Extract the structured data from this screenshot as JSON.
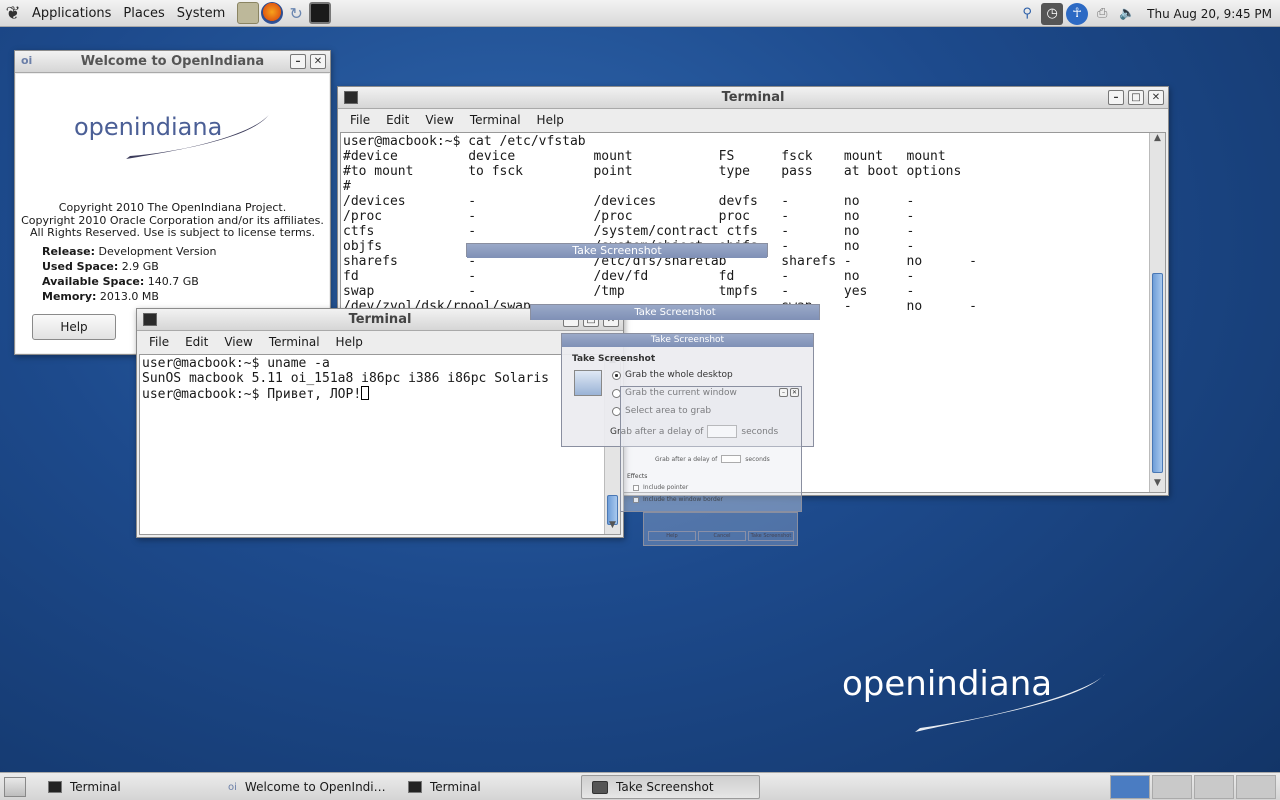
{
  "top_panel": {
    "menus": [
      "Applications",
      "Places",
      "System"
    ],
    "clock": "Thu Aug 20,  9:45 PM",
    "launchers": [
      "home-folder-icon",
      "firefox-icon",
      "update-icon",
      "terminal-icon"
    ],
    "tray_icons": [
      "search-icon",
      "clock-icon",
      "accessibility-icon",
      "printer-icon",
      "volume-icon"
    ]
  },
  "welcome": {
    "title": "Welcome to OpenIndiana",
    "logo_text": "openindiana",
    "copyright": [
      "Copyright 2010 The OpenIndiana Project.",
      "Copyright 2010 Oracle Corporation and/or its affiliates.",
      "All Rights Reserved. Use is subject to license terms."
    ],
    "release_label": "Release:",
    "release_value": "Development Version",
    "used_label": "Used Space:",
    "used_value": "2.9 GB",
    "avail_label": "Available Space:",
    "avail_value": "140.7 GB",
    "mem_label": "Memory:",
    "mem_value": "2013.0 MB",
    "help_button": "Help"
  },
  "terminal_big": {
    "title": "Terminal",
    "menus": [
      "File",
      "Edit",
      "View",
      "Terminal",
      "Help"
    ],
    "lines": [
      "user@macbook:~$ cat /etc/vfstab",
      "#device         device          mount           FS      fsck    mount   mount",
      "#to mount       to fsck         point           type    pass    at boot options",
      "#",
      "/devices        -               /devices        devfs   -       no      -",
      "/proc           -               /proc           proc    -       no      -",
      "ctfs            -               /system/contract ctfs   -       no      -",
      "objfs           -               /system/object  objfs   -       no      -",
      "sharefs         -               /etc/dfs/sharetab       sharefs -       no      -",
      "fd              -               /dev/fd         fd      -       no      -",
      "swap            -               /tmp            tmpfs   -       yes     -",
      "/dev/zvol/dsk/rpool/swap        -               -       swap    -       no      -"
    ]
  },
  "terminal_small": {
    "title": "Terminal",
    "menus": [
      "File",
      "Edit",
      "View",
      "Terminal",
      "Help"
    ],
    "lines": [
      "user@macbook:~$ uname -a",
      "SunOS macbook 5.11 oi_151a8 i86pc i386 i86pc Solaris",
      "user@macbook:~$ Привет, ЛОР!"
    ]
  },
  "screenshot_dialog": {
    "title": "Take Screenshot",
    "section": "Take Screenshot",
    "options": [
      "Grab the whole desktop",
      "Grab the current window",
      "Select area to grab"
    ],
    "delay_label": "Grab after a delay of",
    "delay_unit": "seconds",
    "effects_label": "Effects",
    "effects_options": [
      "Include pointer",
      "Include the window border"
    ],
    "buttons": [
      "Help",
      "Cancel",
      "Take Screenshot"
    ]
  },
  "desktop_logo": "openindiana",
  "taskbar": {
    "items": [
      "Terminal",
      "Welcome to OpenIndi…",
      "Terminal",
      "Take Screenshot"
    ]
  }
}
